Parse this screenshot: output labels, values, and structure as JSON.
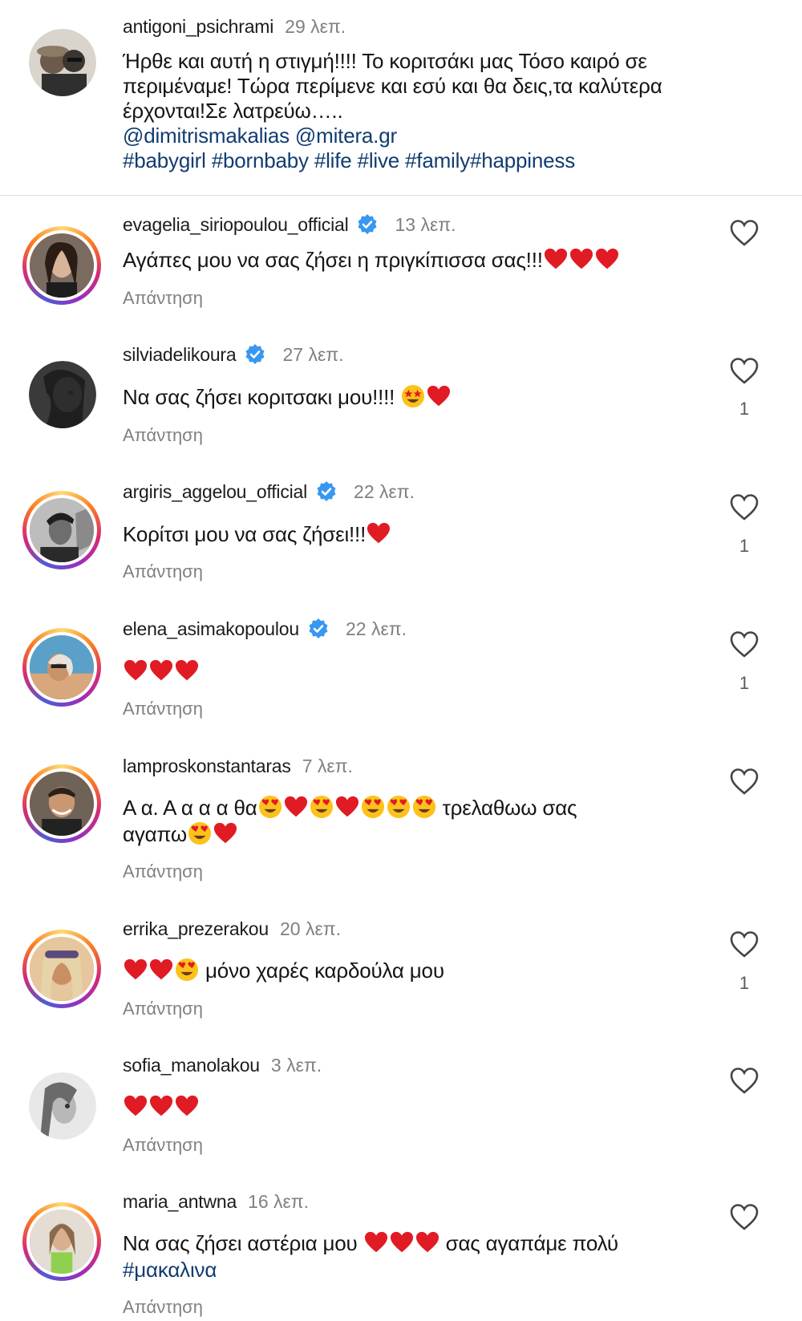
{
  "caption": {
    "username": "antigoni_psichrami",
    "time": "29 λεπ.",
    "line1": "Ήρθε και αυτή η στιγμή!!!! Το κοριτσάκι μας Τόσο καιρό σε",
    "line2": "περιμέναμε! Τώρα περίμενε και εσύ και θα δεις,τα καλύτερα",
    "line3": "έρχονται!Σε λατρεύω…..",
    "mentions": "@dimitrismakalias @mitera.gr",
    "hashtags": "#babygirl #bornbaby #life #live #family#happiness"
  },
  "ui": {
    "reply_label": "Απάντηση",
    "like_icon": "heart-outline-icon",
    "verified_icon": "verified-badge-icon",
    "brand_color": "#3897f0",
    "link_color": "#123c71"
  },
  "comments": [
    {
      "username": "evagelia_siriopoulou_official",
      "verified": true,
      "time": "13 λεπ.",
      "text_a": "Αγάπες μου να σας ζήσει η πριγκίπισσα σας!!!",
      "emoji_a": [
        "red-heart",
        "red-heart",
        "red-heart"
      ],
      "likes": ""
    },
    {
      "username": "silviadelikoura",
      "verified": true,
      "time": "27 λεπ.",
      "text_a": "Να σας ζήσει κοριτσακι μου!!!! ",
      "emoji_a": [
        "star-struck",
        "red-heart"
      ],
      "likes": "1"
    },
    {
      "username": "argiris_aggelou_official",
      "verified": true,
      "time": "22 λεπ.",
      "text_a": "Κορίτσι μου να σας ζήσει!!!",
      "emoji_a": [
        "red-heart"
      ],
      "likes": "1"
    },
    {
      "username": "elena_asimakopoulou",
      "verified": true,
      "time": "22 λεπ.",
      "text_a": "",
      "emoji_a": [
        "red-heart",
        "red-heart",
        "red-heart"
      ],
      "likes": "1"
    },
    {
      "username": "lamproskonstantaras",
      "verified": false,
      "time": "7 λεπ.",
      "text_a": "Α α. Α α α α θα",
      "text_b": " τρελαθωω σας",
      "text_c": "αγαπω",
      "likes": ""
    },
    {
      "username": "errika_prezerakou",
      "verified": false,
      "time": "20 λεπ.",
      "text_a": " μόνο χαρές καρδούλα μου",
      "likes": "1"
    },
    {
      "username": "sofia_manolakou",
      "verified": false,
      "time": "3 λεπ.",
      "text_a": "",
      "likes": ""
    },
    {
      "username": "maria_antwna",
      "verified": false,
      "time": "16 λεπ.",
      "text_a": "Να σας ζήσει αστέρια μου ",
      "text_b": " σας αγαπάμε πολύ",
      "text_c": "#μακαλινα",
      "likes": ""
    }
  ]
}
